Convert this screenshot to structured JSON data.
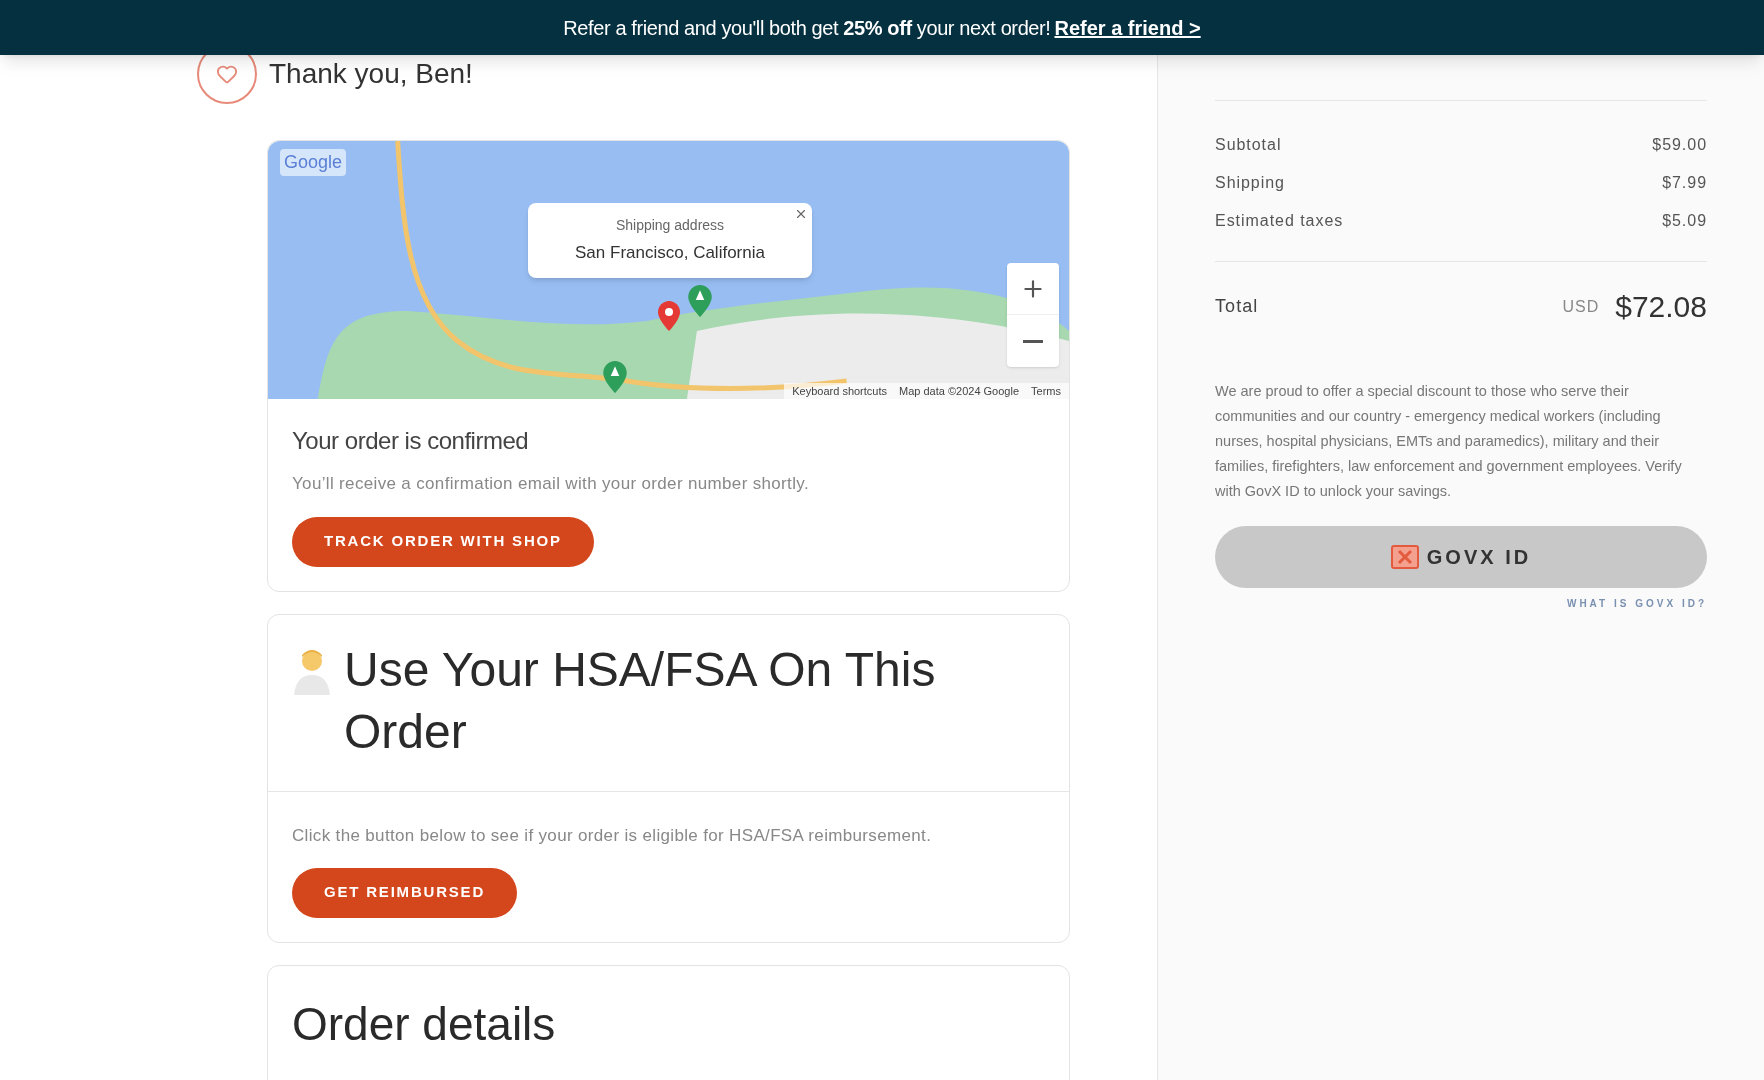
{
  "banner": {
    "text": "Refer a friend and you'll both get **25% off** your next order!",
    "link": "Refer a friend >"
  },
  "header": {
    "title": "Thank you, Ben!"
  },
  "map": {
    "popup": {
      "label": "Shipping address",
      "value": "San Francisco, California"
    },
    "logo": "Google",
    "attribution": [
      "Keyboard shortcuts",
      "Map data ©2024 Google",
      "Terms"
    ]
  },
  "confirmation": {
    "title": "Your order is confirmed",
    "text": "You’ll receive a confirmation email with your order number shortly.",
    "button": "TRACK ORDER WITH SHOP"
  },
  "hsa": {
    "title": "Use Your HSA/FSA On This Order",
    "text": "Click the button below to see if your order is eligible for HSA/FSA reimbursement.",
    "button": "GET REIMBURSED"
  },
  "order_details": {
    "title": "Order details"
  },
  "summary": {
    "rows": [
      {
        "label": "Subtotal",
        "value": "$59.00"
      },
      {
        "label": "Shipping",
        "value": "$7.99"
      },
      {
        "label": "Estimated taxes",
        "value": "$5.09"
      }
    ],
    "total": {
      "label": "Total",
      "currency": "USD",
      "amount": "$72.08"
    }
  },
  "discount": {
    "text": "We are proud to offer a special discount to those who serve their communities and our country - emergency medical workers (including nurses, hospital physicians, EMTs and paramedics), military and their families, firefighters, law enforcement and government employees. Verify with GovX ID to unlock your savings.",
    "button": "GOVX ID",
    "link": "WHAT IS GOVX ID?"
  }
}
